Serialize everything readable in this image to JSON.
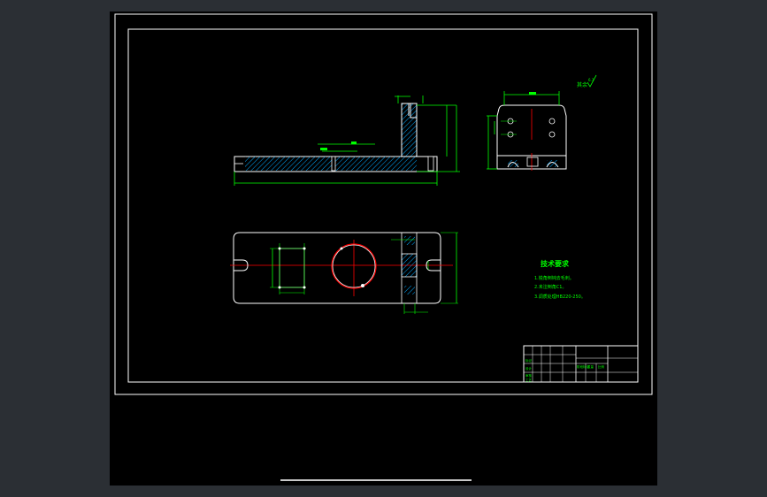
{
  "drawing": {
    "roughness_label": "其余",
    "roughness_value": "6.3",
    "notes_title": "技术要求",
    "notes": [
      "1.锐角倒钝去毛刺。",
      "2.未注倒角C1。",
      "3.调质处理HB220-250。"
    ]
  },
  "title_block": {
    "rows": [
      "标记",
      "设计",
      "审核",
      "工艺"
    ],
    "cells": [
      "阶段标记",
      "重量",
      "比例"
    ]
  },
  "colors": {
    "background": "#000000",
    "outline": "#ffffff",
    "dimension": "#00ff00",
    "centerline": "#ff0000",
    "hatch": "#00a8ff",
    "frame": "#ffffff",
    "viewer_bg": "#2b2f34"
  }
}
